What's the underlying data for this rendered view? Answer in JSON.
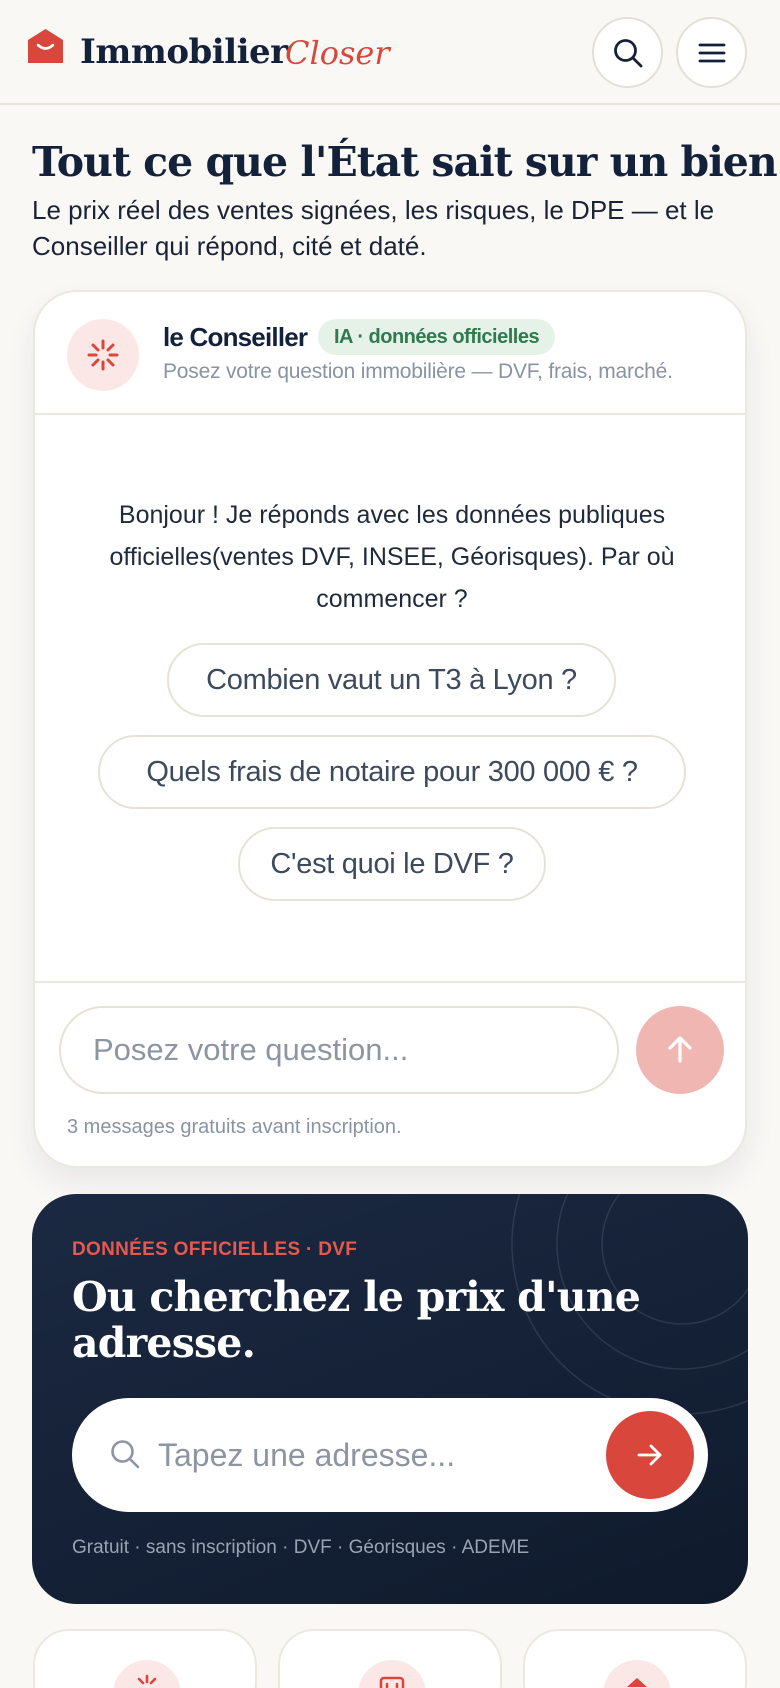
{
  "header": {
    "brand": "Immobilier",
    "brand_accent": "Closer",
    "icons": {
      "logo": "house-icon",
      "search": "search-icon",
      "menu": "menu-icon"
    }
  },
  "hero": {
    "title": "Tout ce que l'État sait sur un bien.",
    "subtitle": "Le prix réel des ventes signées, les risques, le DPE — et le Conseiller qui répond, cité et daté."
  },
  "chat": {
    "name": "le Conseiller",
    "badge": "IA · données officielles",
    "subtitle": "Posez votre question immobilière — DVF, frais, marché.",
    "greeting": "Bonjour ! Je réponds avec les données publiques officielles(ventes DVF, INSEE, Géorisques). Par où commencer ?",
    "suggestions": [
      "Combien vaut un T3 à Lyon ?",
      "Quels frais de notaire pour 300 000 € ?",
      "C'est quoi le DVF ?"
    ],
    "input_placeholder": "Posez votre question...",
    "input_value": "",
    "quota_note": "3 messages gratuits avant inscription.",
    "icons": {
      "avatar": "spark-icon",
      "send": "arrow-up-icon"
    }
  },
  "address_search": {
    "kicker": "DONNÉES OFFICIELLES · DVF",
    "title": "Ou cherchez le prix d'une adresse.",
    "placeholder": "Tapez une adresse...",
    "input_value": "",
    "sources": "Gratuit · sans inscription · DVF · Géorisques · ADEME",
    "icons": {
      "search": "search-icon",
      "submit": "arrow-right-icon"
    }
  },
  "feature_cards": [
    {
      "icon": "spark-icon"
    },
    {
      "icon": "calendar-icon"
    },
    {
      "icon": "house-icon"
    }
  ],
  "colors": {
    "background": "#f9f8f5",
    "navy": "#14213a",
    "accent_red": "#d9463c",
    "send_disabled": "#efb6b2",
    "badge_green": "#2f7a4e",
    "badge_green_bg": "#e6f1e8"
  }
}
